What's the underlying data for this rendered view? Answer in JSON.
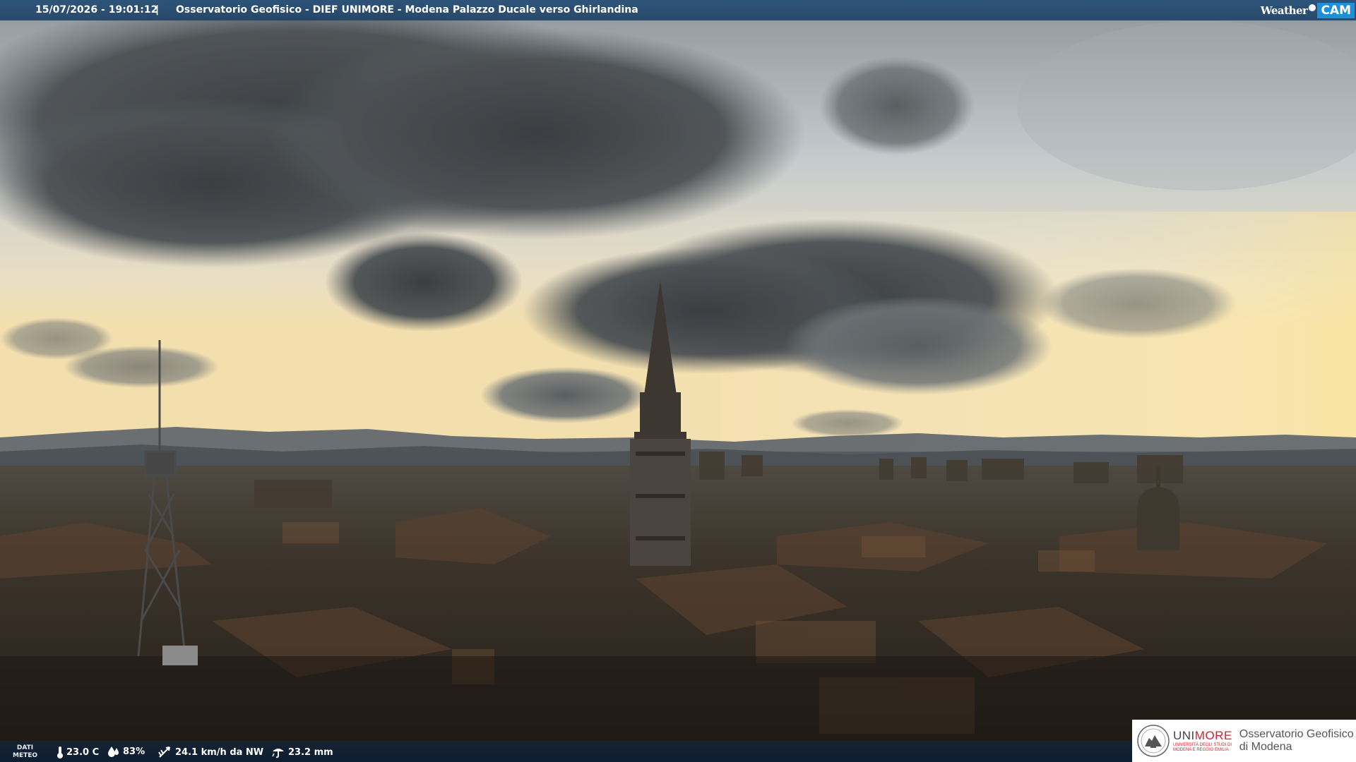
{
  "header": {
    "datetime": "15/07/2026 - 19:01:12",
    "separator": "|",
    "title": "Osservatorio Geofisico - DIEF UNIMORE - Modena Palazzo Ducale verso Ghirlandina",
    "brand_weather": "Weather",
    "brand_cam": "CAM"
  },
  "weather_data": {
    "label_line1": "DATI",
    "label_line2": "METEO",
    "temperature": "23.0 C",
    "humidity": "83%",
    "wind": "24.1 km/h da NW",
    "rain": "23.2 mm",
    "icons": [
      "thermometer-icon",
      "humidity-drop-icon",
      "wind-icon",
      "rain-icon"
    ]
  },
  "logo": {
    "uni_prefix": "UNI",
    "uni_suffix": "MORE",
    "uni_sub_line1": "UNIVERSITÀ DEGLI STUDI DI",
    "uni_sub_line2": "MODENA E REGGIO EMILIA",
    "obs_line1": "Osservatorio Geofisico",
    "obs_line2": "di Modena"
  },
  "colors": {
    "topbar": "#2a5580",
    "cam_blue": "#1e8fd8",
    "unimore_red": "#d2232a"
  }
}
